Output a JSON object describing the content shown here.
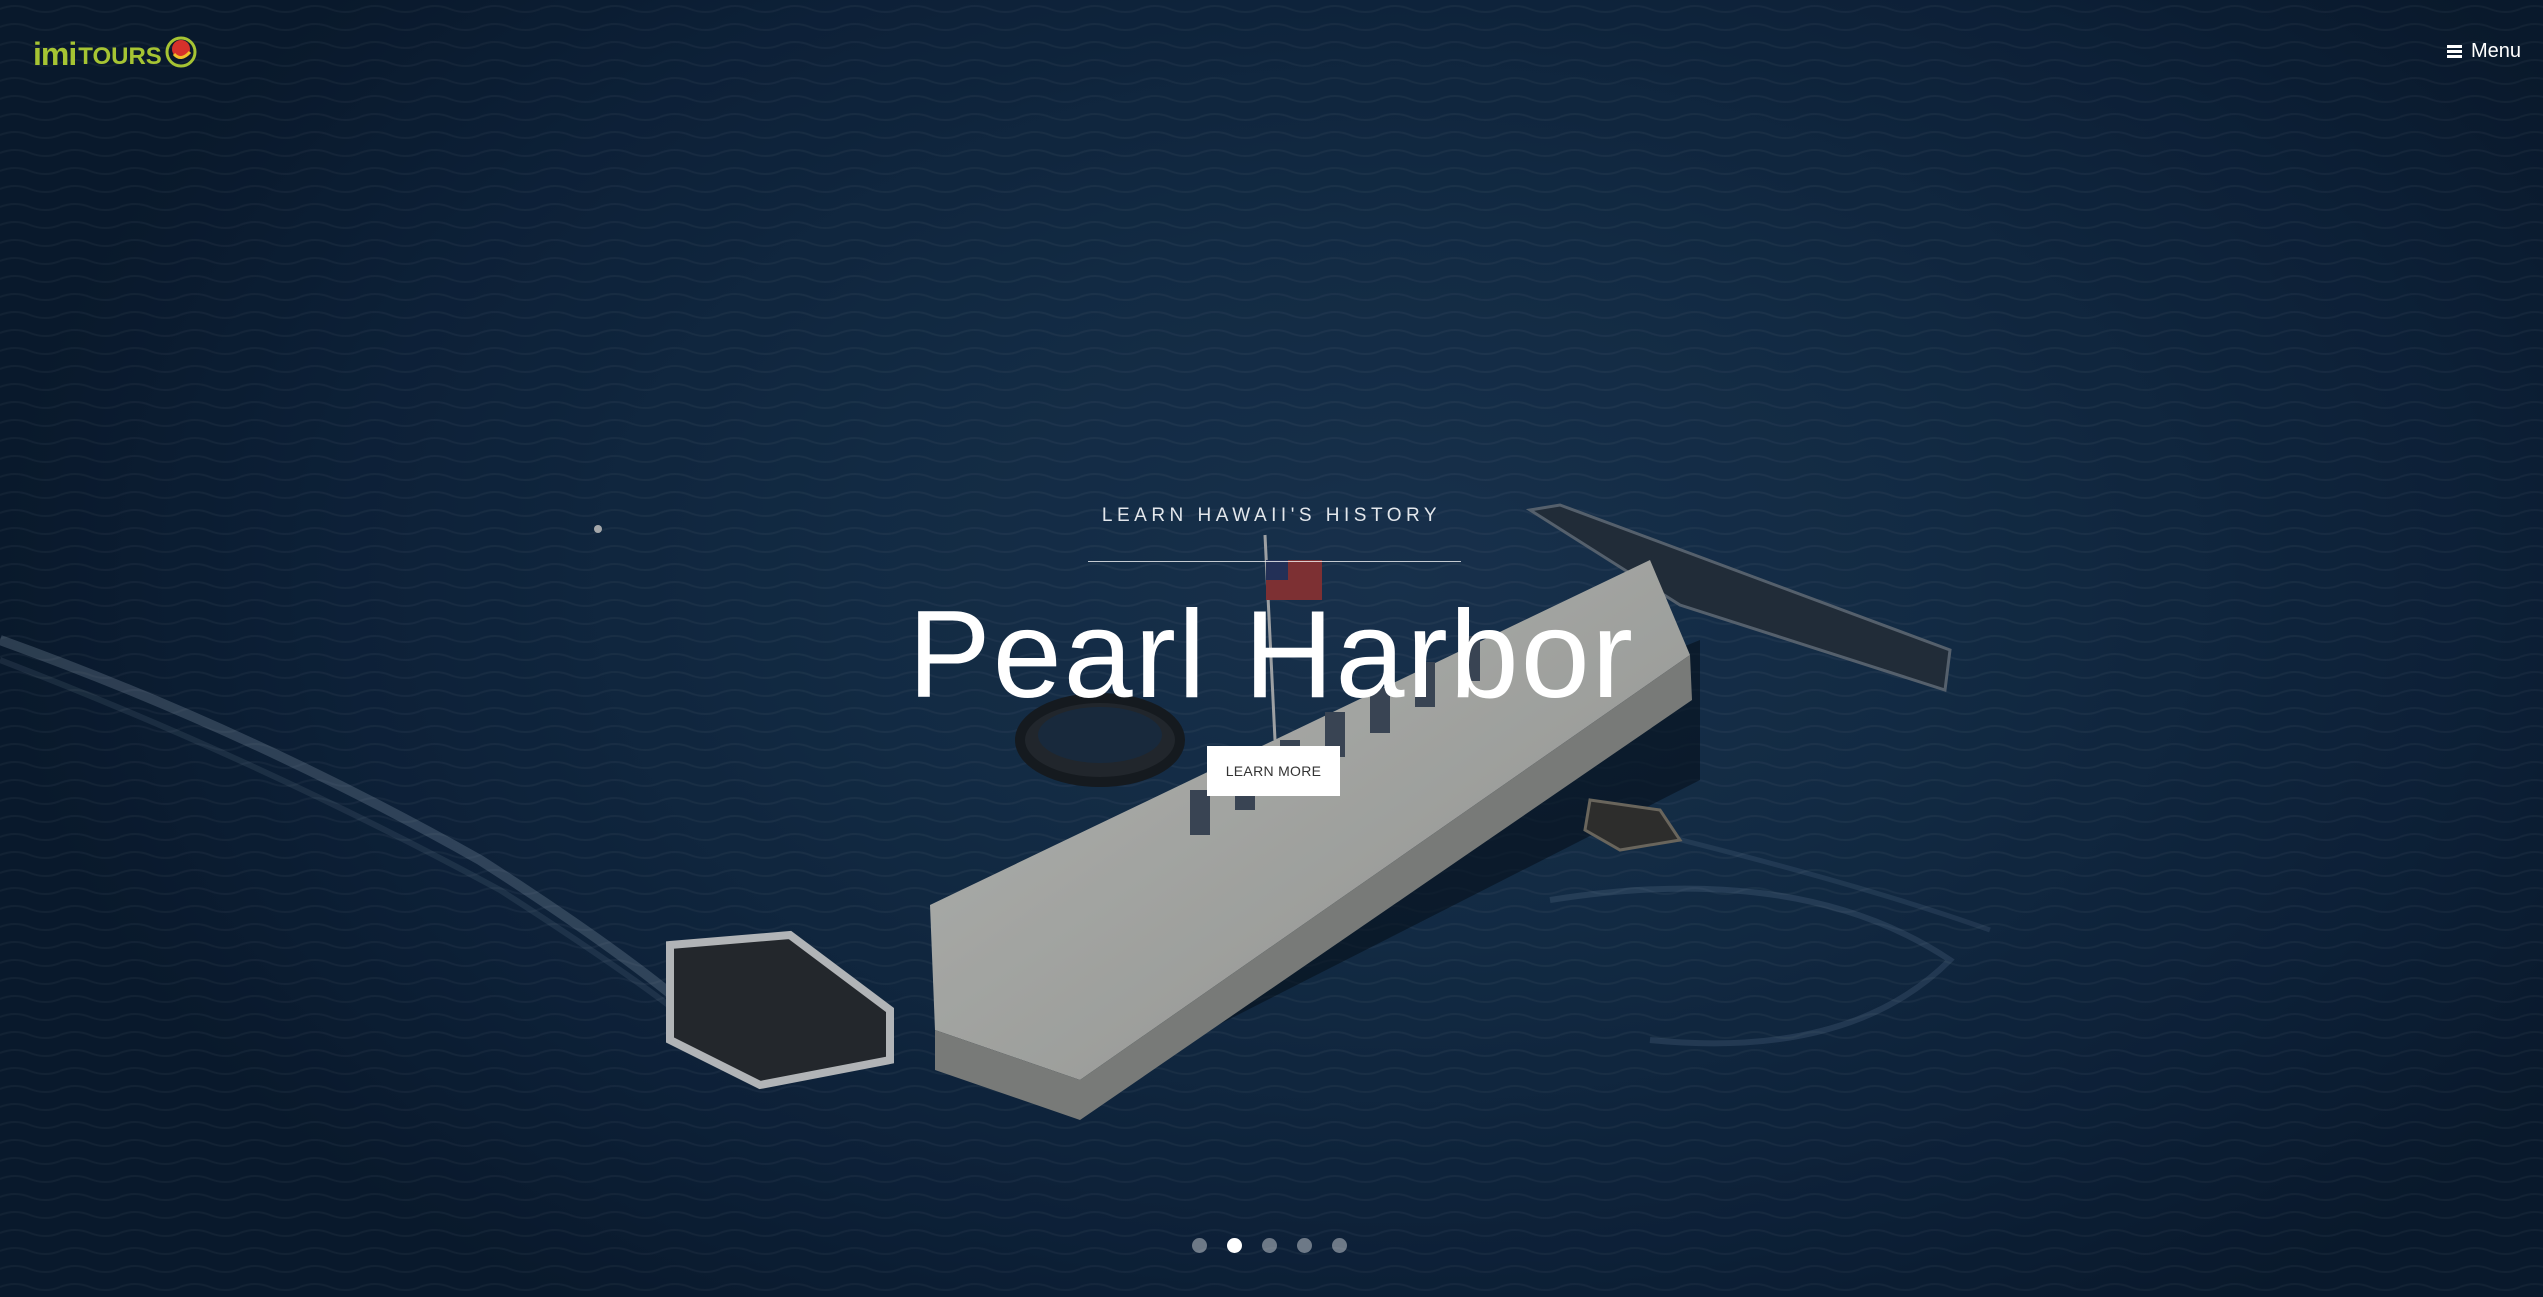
{
  "brand": {
    "logo_imi": "imi",
    "logo_tours": "TOURS",
    "logo_color": "#a6c433"
  },
  "nav": {
    "menu_label": "Menu",
    "menu_icon": "hamburger-icon"
  },
  "hero": {
    "kicker": "LEARN HAWAII'S HISTORY",
    "title": "Pearl Harbor",
    "cta_label": "LEARN MORE"
  },
  "carousel": {
    "slide_count": 5,
    "active_index": 1,
    "dots": [
      {
        "label": "slide-1"
      },
      {
        "label": "slide-2"
      },
      {
        "label": "slide-3"
      },
      {
        "label": "slide-4"
      },
      {
        "label": "slide-5"
      }
    ]
  },
  "colors": {
    "water_dark": "#0f2540",
    "water_mid": "#1d3a5a",
    "text_white": "#ffffff"
  }
}
